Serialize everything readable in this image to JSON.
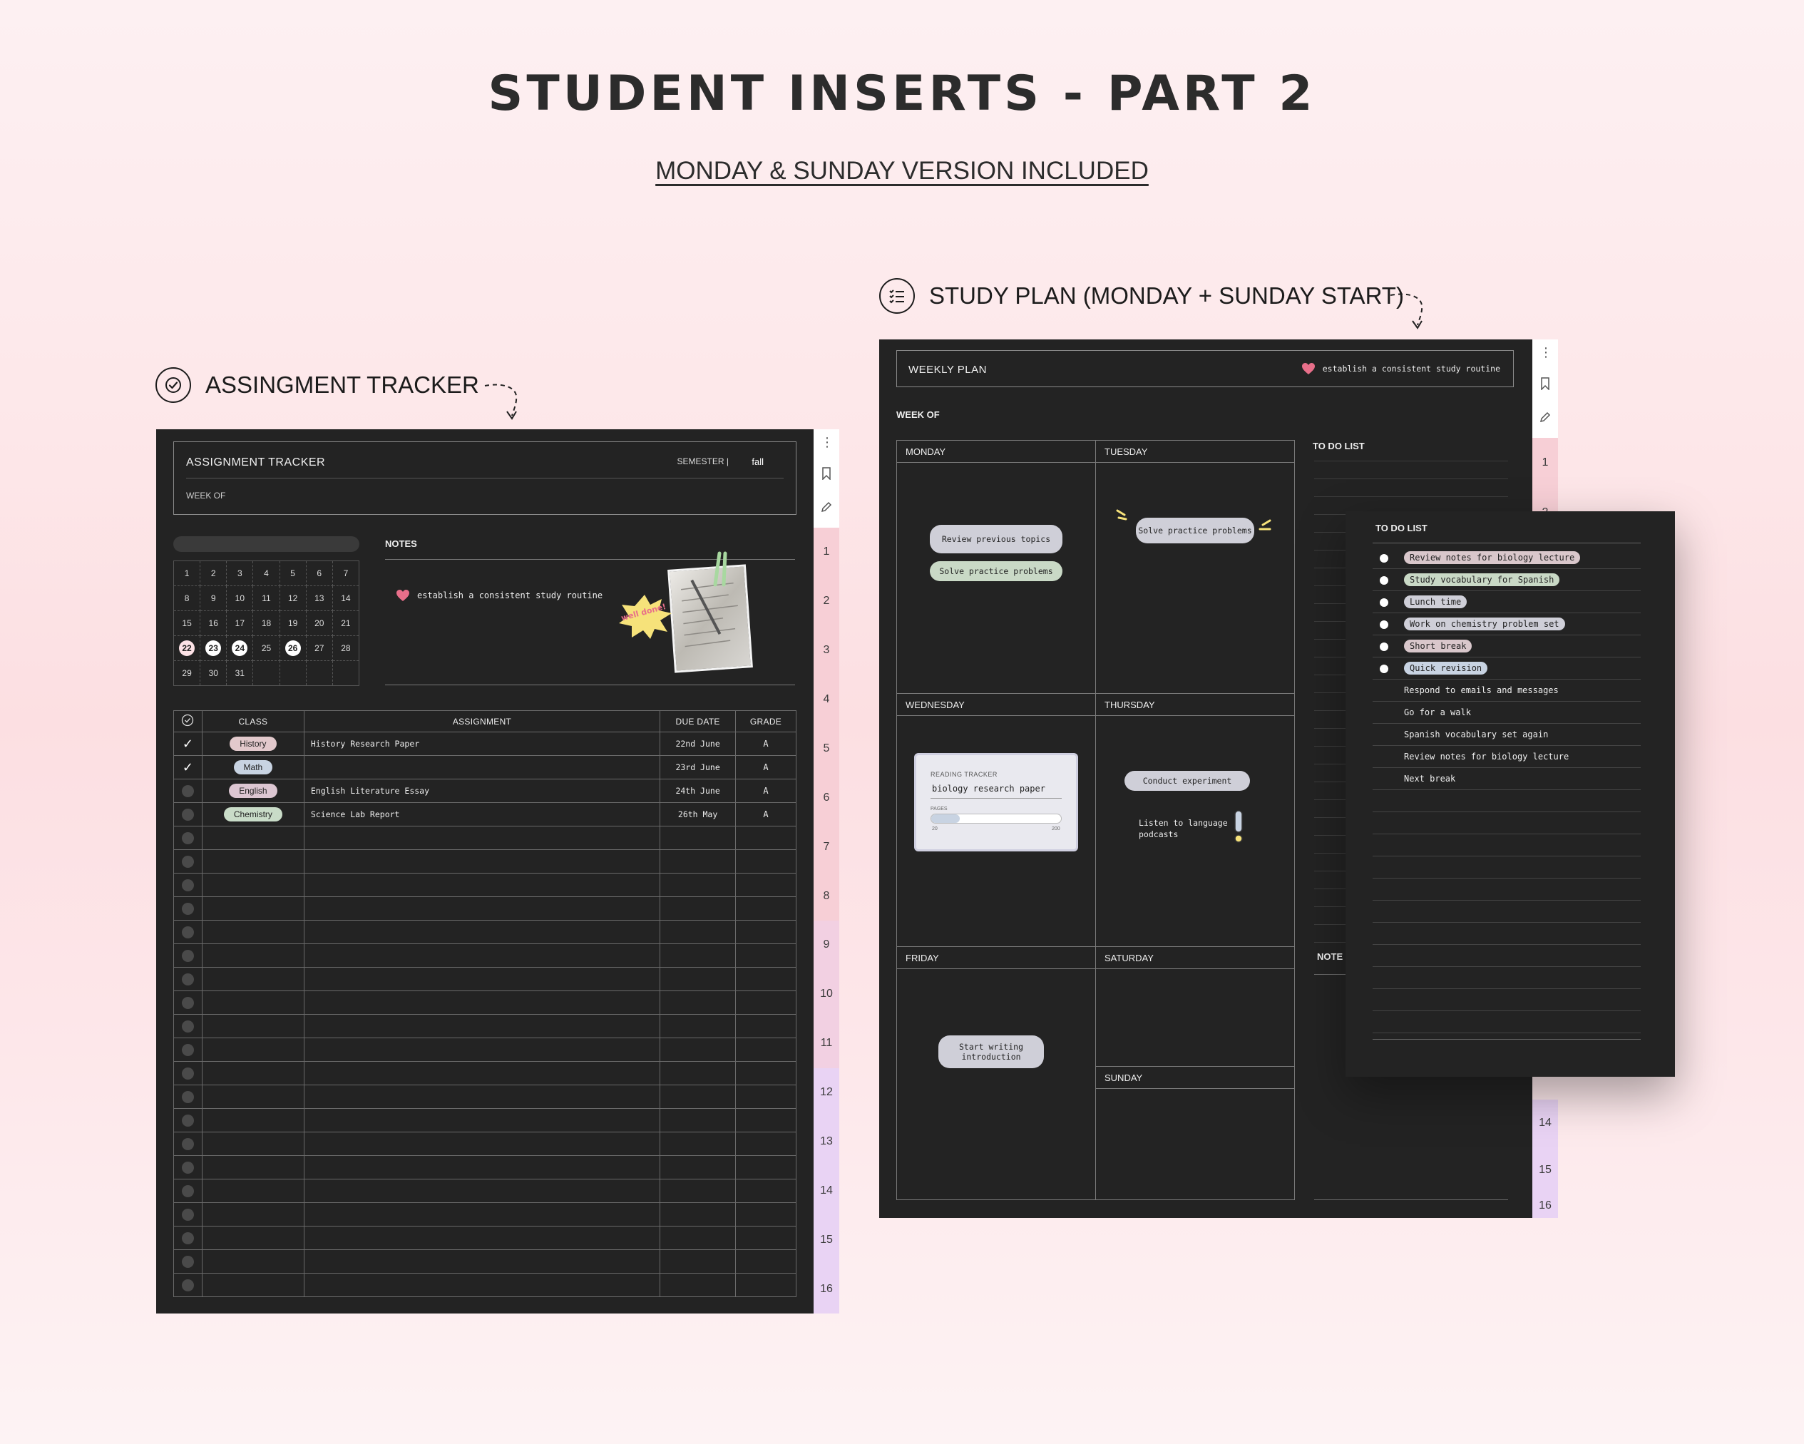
{
  "heading": {
    "title": "STUDENT INSERTS - PART 2",
    "subtitle": "MONDAY & SUNDAY VERSION INCLUDED"
  },
  "sections": {
    "assignment_label": "ASSINGMENT TRACKER",
    "study_label": "STUDY PLAN (MONDAY + SUNDAY START)"
  },
  "assignment_tracker": {
    "title": "ASSIGNMENT TRACKER",
    "semester_label": "SEMESTER |",
    "semester_value": "fall",
    "week_of": "WEEK OF",
    "notes_title": "NOTES",
    "goal": "establish a consistent study routine",
    "sticker": "well done!",
    "calendar": [
      [
        "1",
        "2",
        "3",
        "4",
        "5",
        "6",
        "7"
      ],
      [
        "8",
        "9",
        "10",
        "11",
        "12",
        "13",
        "14"
      ],
      [
        "15",
        "16",
        "17",
        "18",
        "19",
        "20",
        "21"
      ],
      [
        "22",
        "23",
        "24",
        "25",
        "26",
        "27",
        "28"
      ],
      [
        "29",
        "30",
        "31",
        "",
        "",
        "",
        ""
      ]
    ],
    "table": {
      "headers": [
        "CLASS",
        "ASSIGNMENT",
        "DUE DATE",
        "GRADE"
      ],
      "rows": [
        {
          "checked": true,
          "class": "History",
          "class_color": "#e2c9cc",
          "assignment": "History Research Paper",
          "due": "22nd June",
          "grade": "A"
        },
        {
          "checked": true,
          "class": "Math",
          "class_color": "#c8d3e2",
          "assignment": "",
          "due": "23rd June",
          "grade": "A"
        },
        {
          "checked": false,
          "class": "English",
          "class_color": "#dcc6d2",
          "assignment": "English Literature Essay",
          "due": "24th June",
          "grade": "A"
        },
        {
          "checked": false,
          "class": "Chemistry",
          "class_color": "#c9dcc8",
          "assignment": "Science Lab Report",
          "due": "26th May",
          "grade": "A"
        }
      ],
      "empty_rows": 20
    },
    "tabs": [
      "1",
      "2",
      "3",
      "4",
      "5",
      "6",
      "7",
      "8",
      "9",
      "10",
      "11",
      "12",
      "13",
      "14",
      "15",
      "16"
    ]
  },
  "weekly_plan": {
    "title": "WEEKLY PLAN",
    "goal": "establish a consistent study routine",
    "week_of": "WEEK OF",
    "days": [
      "MONDAY",
      "TUESDAY",
      "WEDNESDAY",
      "THURSDAY",
      "FRIDAY",
      "SATURDAY",
      "SUNDAY"
    ],
    "todo_title": "TO DO LIST",
    "notes_title": "NOTE",
    "tasks": {
      "monday_1": "Review previous topics",
      "monday_2": "Solve practice problems",
      "tuesday_1": "Solve practice problems",
      "thursday_1": "Conduct experiment",
      "thursday_2": "Listen to language podcasts",
      "friday_1": "Start writing introduction"
    },
    "reading_tracker": {
      "label": "READING TRACKER",
      "book": "biology research paper",
      "pages_label": "PAGES",
      "start": "20",
      "end": "200"
    },
    "tabs": [
      "1",
      "2",
      "14",
      "15",
      "16"
    ]
  },
  "todo_overlay": {
    "title": "TO DO LIST",
    "items": [
      {
        "text": "Review notes for biology lecture",
        "color": "#d9c7cb",
        "dot": true
      },
      {
        "text": "Study vocabulary for Spanish",
        "color": "#c9d9c6",
        "dot": true
      },
      {
        "text": "Lunch time",
        "color": "#cfcfd8",
        "dot": true
      },
      {
        "text": "Work on chemistry problem set",
        "color": "#cfcfd8",
        "dot": true
      },
      {
        "text": "Short break",
        "color": "#d9c7cb",
        "dot": true
      },
      {
        "text": "Quick revision",
        "color": "#c8d3e2",
        "dot": true
      },
      {
        "text": "Respond to emails and messages",
        "color": "",
        "dot": false
      },
      {
        "text": "Go for a walk",
        "color": "",
        "dot": false
      },
      {
        "text": "Spanish vocabulary set again",
        "color": "",
        "dot": false
      },
      {
        "text": "Review notes for biology lecture",
        "color": "",
        "dot": false
      },
      {
        "text": "Next break",
        "color": "",
        "dot": false
      }
    ]
  },
  "colors": {
    "panel": "#232323",
    "heart": "#e86f8a",
    "sticker": "#f6e27a",
    "tab_pink": "#f7cfd6",
    "tab_lilac": "#e9d3f4"
  }
}
